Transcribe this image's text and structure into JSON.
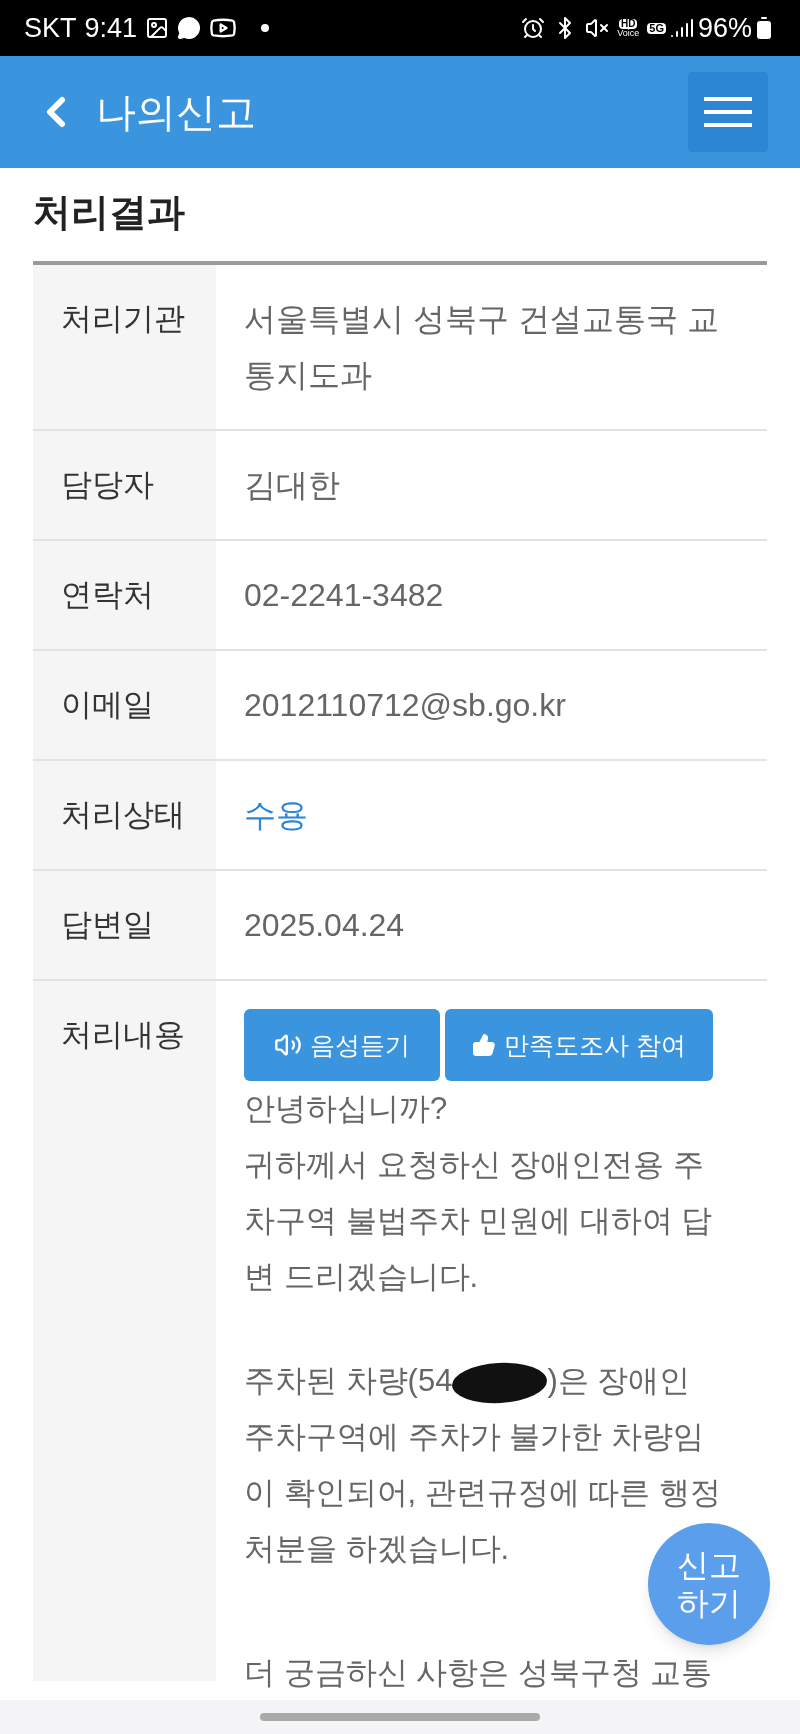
{
  "status_bar": {
    "carrier": "SKT",
    "time": "9:41",
    "hd_label": "HD",
    "voice_label": "Voice",
    "network": "5G",
    "battery": "96%"
  },
  "header": {
    "title": "나의신고"
  },
  "section_title": "처리결과",
  "rows": [
    {
      "label": "처리기관",
      "value": "서울특별시 성북구 건설교통국 교통지도과",
      "kind": "text"
    },
    {
      "label": "담당자",
      "value": "김대한",
      "kind": "text"
    },
    {
      "label": "연락처",
      "value": "02-2241-3482",
      "kind": "text"
    },
    {
      "label": "이메일",
      "value": "2012110712@sb.go.kr",
      "kind": "text"
    },
    {
      "label": "처리상태",
      "value": "수용",
      "kind": "status"
    },
    {
      "label": "답변일",
      "value": "2025.04.24",
      "kind": "text"
    }
  ],
  "content_row": {
    "label": "처리내용",
    "buttons": [
      {
        "label": "음성듣기",
        "kind": "audio"
      },
      {
        "label": "만족도조사 참여",
        "kind": "survey"
      }
    ],
    "paragraphs": [
      {
        "lines": [
          "안녕하십니까?",
          "귀하께서 요청하신 장애인전용 주차구역 불법주차 민원에 대하여 답변 드리겠습니다."
        ]
      },
      {
        "before_redaction": "주차된 차량(54",
        "after_redaction": ")은 장애인",
        "lines": [
          "주차구역에 주차가 불가한 차량임",
          "이 확인되어, 관련규정에 따른 행정",
          "처분을 하겠습니다."
        ]
      },
      {
        "lines": [
          "더 궁금하신 사항은 성북구청 교통"
        ]
      }
    ]
  },
  "fab": {
    "label": "신고\n하기"
  }
}
